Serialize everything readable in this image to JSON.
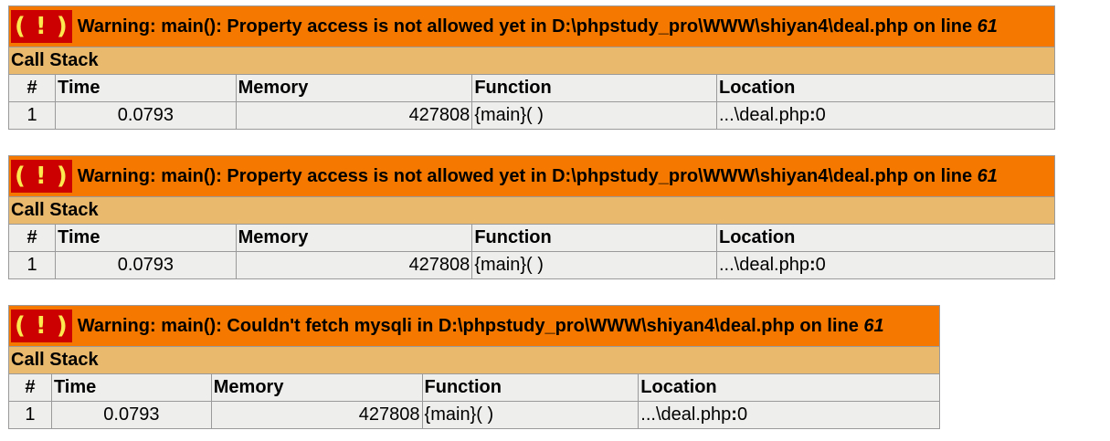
{
  "errors": [
    {
      "badge": "( ! )",
      "message": "Warning: main(): Property access is not allowed yet in D:\\phpstudy_pro\\WWW\\shiyan4\\deal.php on line ",
      "line": "61",
      "call_stack_label": "Call Stack",
      "columns": [
        "#",
        "Time",
        "Memory",
        "Function",
        "Location"
      ],
      "rows": [
        {
          "num": "1",
          "time": "0.0793",
          "memory": "427808",
          "function": "{main}( )",
          "location_file": "...\\deal.php",
          "location_sep": ":",
          "location_line": "0"
        }
      ]
    },
    {
      "badge": "( ! )",
      "message": "Warning: main(): Property access is not allowed yet in D:\\phpstudy_pro\\WWW\\shiyan4\\deal.php on line ",
      "line": "61",
      "call_stack_label": "Call Stack",
      "columns": [
        "#",
        "Time",
        "Memory",
        "Function",
        "Location"
      ],
      "rows": [
        {
          "num": "1",
          "time": "0.0793",
          "memory": "427808",
          "function": "{main}( )",
          "location_file": "...\\deal.php",
          "location_sep": ":",
          "location_line": "0"
        }
      ]
    },
    {
      "badge": "( ! )",
      "message": "Warning: main(): Couldn't fetch mysqli in D:\\phpstudy_pro\\WWW\\shiyan4\\deal.php on line ",
      "line": "61",
      "call_stack_label": "Call Stack",
      "columns": [
        "#",
        "Time",
        "Memory",
        "Function",
        "Location"
      ],
      "rows": [
        {
          "num": "1",
          "time": "0.0793",
          "memory": "427808",
          "function": "{main}( )",
          "location_file": "...\\deal.php",
          "location_sep": ":",
          "location_line": "0"
        }
      ]
    }
  ],
  "colors": {
    "title_bg": "#f57900",
    "badge_bg": "#cc0000",
    "badge_fg": "#fce94f",
    "call_stack_bg": "#e9b96e",
    "cell_bg": "#eeeeec"
  }
}
